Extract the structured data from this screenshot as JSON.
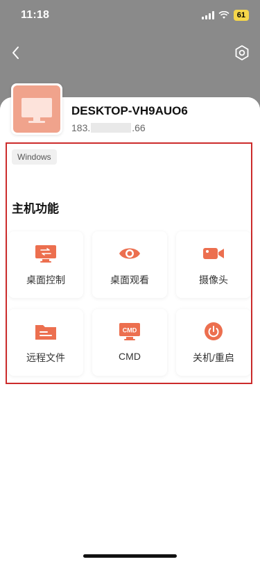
{
  "status_bar": {
    "time": "11:18",
    "battery": "61"
  },
  "device": {
    "name": "DESKTOP-VH9AUO6",
    "ip_prefix": "183.",
    "ip_suffix": ".66",
    "os": "Windows"
  },
  "section_title": "主机功能",
  "functions": [
    {
      "label": "桌面控制",
      "icon": "desktop-control-icon"
    },
    {
      "label": "桌面观看",
      "icon": "eye-icon"
    },
    {
      "label": "摄像头",
      "icon": "camera-icon"
    },
    {
      "label": "远程文件",
      "icon": "folder-icon"
    },
    {
      "label": "CMD",
      "icon": "cmd-icon",
      "icon_text": "CMD"
    },
    {
      "label": "关机/重启",
      "icon": "power-icon"
    }
  ],
  "colors": {
    "accent": "#ec6f4f",
    "accent_light": "#f0a38c",
    "highlight_border": "#cc2b2b"
  }
}
